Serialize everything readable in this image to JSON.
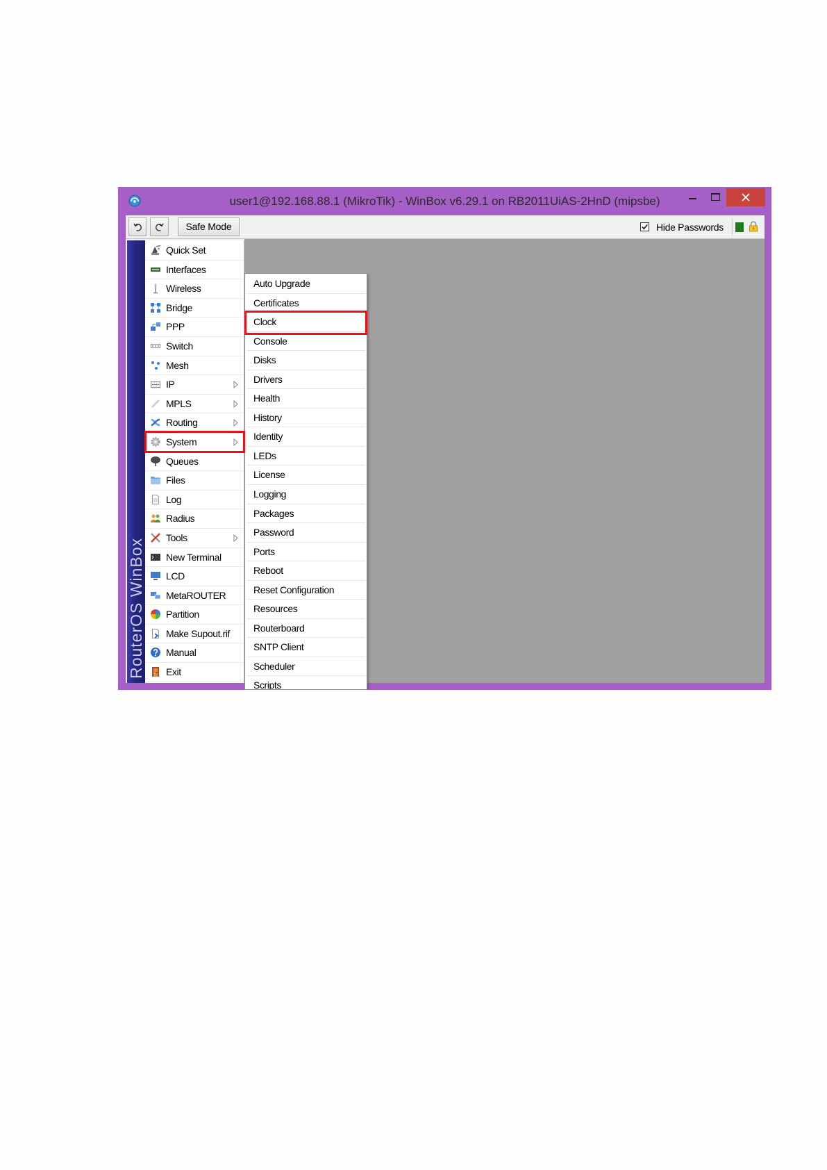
{
  "window": {
    "title": "user1@192.168.88.1 (MikroTik) - WinBox v6.29.1 on RB2011UiAS-2HnD (mipsbe)",
    "app_icon": "winbox-app-icon",
    "controls": [
      "minimize-icon",
      "maximize-icon",
      "close-icon"
    ]
  },
  "toolbar": {
    "undo_icon": "undo-icon",
    "redo_icon": "redo-icon",
    "safe_mode_label": "Safe Mode",
    "hide_passwords": {
      "label": "Hide Passwords",
      "checked": true
    },
    "status_icons": [
      "green-status-icon",
      "lock-icon"
    ]
  },
  "sidebar": {
    "brand": "RouterOS WinBox",
    "items": [
      {
        "label": "Quick Set",
        "icon": "quick-set-icon"
      },
      {
        "label": "Interfaces",
        "icon": "interfaces-icon"
      },
      {
        "label": "Wireless",
        "icon": "wireless-icon"
      },
      {
        "label": "Bridge",
        "icon": "bridge-icon"
      },
      {
        "label": "PPP",
        "icon": "ppp-icon"
      },
      {
        "label": "Switch",
        "icon": "switch-icon"
      },
      {
        "label": "Mesh",
        "icon": "mesh-icon"
      },
      {
        "label": "IP",
        "icon": "ip-icon",
        "has_submenu": true
      },
      {
        "label": "MPLS",
        "icon": "mpls-icon",
        "has_submenu": true
      },
      {
        "label": "Routing",
        "icon": "routing-icon",
        "has_submenu": true
      },
      {
        "label": "System",
        "icon": "system-icon",
        "has_submenu": true,
        "highlighted": true
      },
      {
        "label": "Queues",
        "icon": "queues-icon"
      },
      {
        "label": "Files",
        "icon": "files-icon"
      },
      {
        "label": "Log",
        "icon": "log-icon"
      },
      {
        "label": "Radius",
        "icon": "radius-icon"
      },
      {
        "label": "Tools",
        "icon": "tools-icon",
        "has_submenu": true
      },
      {
        "label": "New Terminal",
        "icon": "new-terminal-icon"
      },
      {
        "label": "LCD",
        "icon": "lcd-icon"
      },
      {
        "label": "MetaROUTER",
        "icon": "metarouter-icon"
      },
      {
        "label": "Partition",
        "icon": "partition-icon"
      },
      {
        "label": "Make Supout.rif",
        "icon": "make-supout-icon"
      },
      {
        "label": "Manual",
        "icon": "manual-icon"
      },
      {
        "label": "Exit",
        "icon": "exit-icon"
      }
    ]
  },
  "submenu": {
    "items": [
      {
        "label": "Auto Upgrade"
      },
      {
        "label": "Certificates"
      },
      {
        "label": "Clock",
        "highlighted": true
      },
      {
        "label": "Console"
      },
      {
        "label": "Disks"
      },
      {
        "label": "Drivers"
      },
      {
        "label": "Health"
      },
      {
        "label": "History"
      },
      {
        "label": "Identity"
      },
      {
        "label": "LEDs"
      },
      {
        "label": "License"
      },
      {
        "label": "Logging"
      },
      {
        "label": "Packages"
      },
      {
        "label": "Password"
      },
      {
        "label": "Ports"
      },
      {
        "label": "Reboot"
      },
      {
        "label": "Reset Configuration"
      },
      {
        "label": "Resources"
      },
      {
        "label": "Routerboard"
      },
      {
        "label": "SNTP Client"
      },
      {
        "label": "Scheduler"
      },
      {
        "label": "Scripts"
      }
    ]
  },
  "colors": {
    "title_bar": "#a55fc7",
    "close_button": "#c7433b",
    "workspace": "#a0a0a0",
    "brand_band": "#25257f",
    "annotation_highlight": "#e3141b",
    "status_green": "#1e7a1e"
  }
}
